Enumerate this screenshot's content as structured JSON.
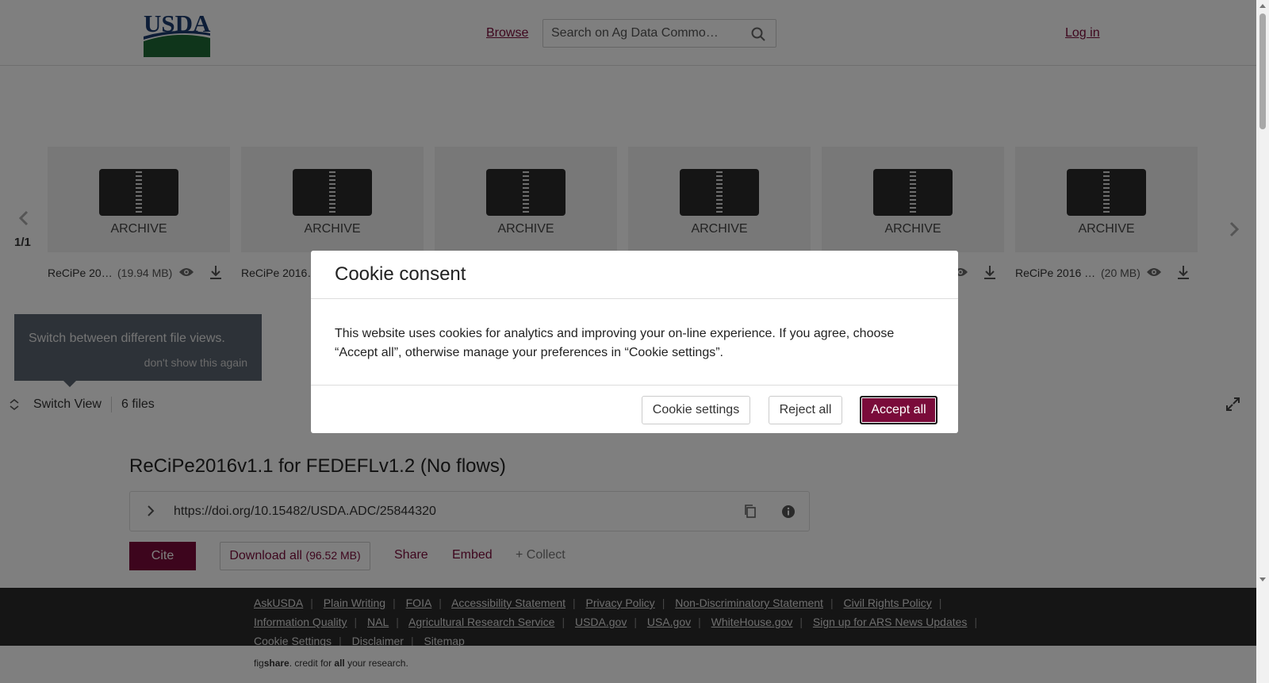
{
  "header": {
    "logo_text": "USDA",
    "browse_label": "Browse",
    "search_placeholder": "Search on Ag Data Commo…",
    "login_label": "Log in"
  },
  "carousel": {
    "page_count": "1/1",
    "files": [
      {
        "type_label": "ARCHIVE",
        "name": "ReCiPe 20…",
        "size": "(19.94 MB)"
      },
      {
        "type_label": "ARCHIVE",
        "name": "ReCiPe 2016…",
        "size": ""
      },
      {
        "type_label": "ARCHIVE",
        "name": "",
        "size": ""
      },
      {
        "type_label": "ARCHIVE",
        "name": "",
        "size": ""
      },
      {
        "type_label": "ARCHIVE",
        "name": "",
        "size": ""
      },
      {
        "type_label": "ARCHIVE",
        "name": "ReCiPe 2016 …",
        "size": "(20 MB)"
      }
    ]
  },
  "tooltip": {
    "text": "Switch between different file views.",
    "dismiss_label": "don't show this again"
  },
  "view_bar": {
    "switch_label": "Switch View",
    "files_count": "6 files"
  },
  "article": {
    "title": "ReCiPe2016v1.1 for FEDEFLv1.2 (No flows)",
    "doi": "https://doi.org/10.15482/USDA.ADC/25844320",
    "cite_label": "Cite",
    "download_label": "Download all",
    "download_size": "(96.52 MB)",
    "share_label": "Share",
    "embed_label": "Embed",
    "collect_label": "+ Collect"
  },
  "footer": {
    "row1": [
      "AskUSDA",
      "Plain Writing",
      "FOIA",
      "Accessibility Statement",
      "Privacy Policy",
      "Non-Discriminatory Statement",
      "Civil Rights Policy"
    ],
    "row2": [
      "Information Quality",
      "NAL",
      "Agricultural Research Service",
      "USDA.gov",
      "USA.gov",
      "WhiteHouse.gov",
      "Sign up for ARS News Updates"
    ],
    "row3": [
      "Cookie Settings",
      "Disclaimer",
      "Sitemap"
    ],
    "fig_prefix": "fig",
    "fig_bold": "share",
    "fig_mid": ". credit for ",
    "fig_bold2": "all",
    "fig_suffix": " your research."
  },
  "cookie_modal": {
    "title": "Cookie consent",
    "body": "This website uses cookies for analytics and improving your on-line experience. If you agree, choose “Accept all”, otherwise manage your preferences in “Cookie settings”.",
    "settings_label": "Cookie settings",
    "reject_label": "Reject all",
    "accept_label": "Accept all"
  },
  "colors": {
    "brand": "#7a0b3a",
    "footer_bg": "#2b2b2b",
    "overlay": "rgba(0,0,0,0.5)"
  }
}
